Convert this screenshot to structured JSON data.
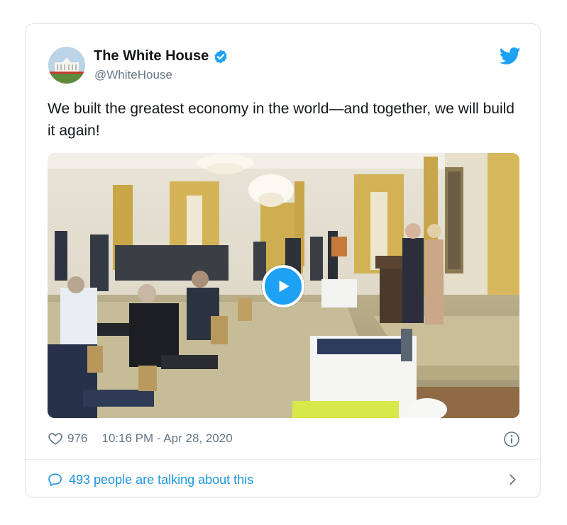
{
  "tweet": {
    "author_name": "The White House",
    "author_handle": "@WhiteHouse",
    "text": "We built the greatest economy in the world—and together, we will build it again!",
    "likes": "976",
    "timestamp": "10:16 PM - Apr 28, 2020",
    "talking_text": "493 people are talking about this"
  },
  "icons": {
    "verified": "verified-badge-icon",
    "bird": "twitter-bird-icon",
    "heart": "heart-icon",
    "info": "info-icon",
    "bubble": "speech-bubble-icon",
    "chevron": "chevron-right-icon",
    "play": "play-icon"
  },
  "colors": {
    "brand_blue": "#1da1f2",
    "link_blue": "#1b95e0",
    "muted": "#657786",
    "text": "#14171a"
  }
}
